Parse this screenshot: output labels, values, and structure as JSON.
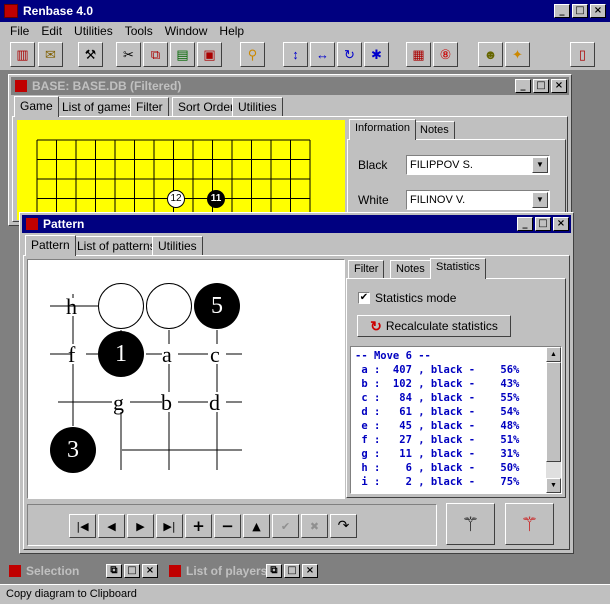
{
  "app": {
    "title": "Renbase 4.0",
    "menu": [
      "File",
      "Edit",
      "Utilities",
      "Tools",
      "Window",
      "Help"
    ]
  },
  "base_window": {
    "title": "BASE: BASE.DB (Filtered)",
    "tabs": [
      "Game",
      "List of games",
      "Filter",
      "Sort Order",
      "Utilities"
    ],
    "info_tabs": [
      "Information",
      "Notes"
    ],
    "black_label": "Black",
    "black_value": "FILIPPOV S.",
    "white_label": "White",
    "white_value": "FILINOV V.",
    "board_stones": [
      {
        "label": "12",
        "color": "white"
      },
      {
        "label": "11",
        "color": "black"
      }
    ]
  },
  "pattern_window": {
    "title": "Pattern",
    "tabs": [
      "Pattern",
      "List of patterns",
      "Utilities"
    ],
    "right_tabs": [
      "Filter",
      "Notes",
      "Statistics"
    ],
    "stats_mode_label": "Statistics mode",
    "stats_mode_checked": true,
    "recalc_label": "Recalculate statistics",
    "stats_header": "-- Move 6 --",
    "stats_rows": [
      {
        "key": "a",
        "count": 407,
        "color": "black",
        "pct": "56%"
      },
      {
        "key": "b",
        "count": 102,
        "color": "black",
        "pct": "43%"
      },
      {
        "key": "c",
        "count": 84,
        "color": "black",
        "pct": "55%"
      },
      {
        "key": "d",
        "count": 61,
        "color": "black",
        "pct": "54%"
      },
      {
        "key": "e",
        "count": 45,
        "color": "black",
        "pct": "48%"
      },
      {
        "key": "f",
        "count": 27,
        "color": "black",
        "pct": "51%"
      },
      {
        "key": "g",
        "count": 11,
        "color": "black",
        "pct": "31%"
      },
      {
        "key": "h",
        "count": 6,
        "color": "black",
        "pct": "50%"
      },
      {
        "key": "i",
        "count": 2,
        "color": "black",
        "pct": "75%"
      }
    ],
    "diagram": {
      "letters": [
        "h",
        "f",
        "a",
        "c",
        "g",
        "b",
        "d"
      ],
      "stones": [
        {
          "label": "",
          "color": "white"
        },
        {
          "label": "",
          "color": "white"
        },
        {
          "label": "5",
          "color": "black"
        },
        {
          "label": "1",
          "color": "black"
        },
        {
          "label": "3",
          "color": "black"
        }
      ]
    }
  },
  "minimized": [
    {
      "title": "Selection"
    },
    {
      "title": "List of players"
    }
  ],
  "status_text": "Copy diagram to Clipboard",
  "colors": {
    "titlebar": "#000080",
    "face": "#c0c0c0",
    "board": "#ffff00",
    "stats_text": "#0000c0"
  }
}
